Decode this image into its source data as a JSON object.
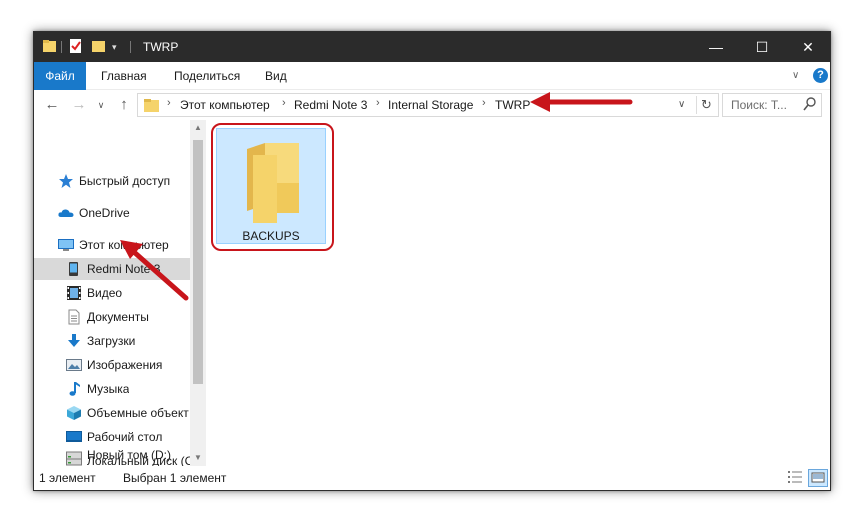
{
  "window": {
    "title": "TWRP",
    "controls": {
      "minimize": "—",
      "maximize": "☐",
      "close": "✕"
    }
  },
  "ribbon": {
    "tabs": [
      {
        "label": "Файл"
      },
      {
        "label": "Главная"
      },
      {
        "label": "Поделиться"
      },
      {
        "label": "Вид"
      }
    ],
    "help": "?"
  },
  "address": {
    "crumbs": [
      "Этот компьютер",
      "Redmi Note 3",
      "Internal Storage",
      "TWRP"
    ],
    "search_placeholder": "Поиск: Т..."
  },
  "nav": {
    "items": [
      {
        "label": "Быстрый доступ",
        "icon": "star-icon"
      },
      {
        "label": "OneDrive",
        "icon": "cloud-icon"
      },
      {
        "label": "Этот компьютер",
        "icon": "computer-icon"
      },
      {
        "label": "Redmi Note 3",
        "icon": "phone-icon",
        "selected": true
      },
      {
        "label": "Видео",
        "icon": "video-icon"
      },
      {
        "label": "Документы",
        "icon": "document-icon"
      },
      {
        "label": "Загрузки",
        "icon": "download-icon"
      },
      {
        "label": "Изображения",
        "icon": "image-icon"
      },
      {
        "label": "Музыка",
        "icon": "music-icon"
      },
      {
        "label": "Объемные объект",
        "icon": "cube-icon"
      },
      {
        "label": "Рабочий стол",
        "icon": "desktop-icon"
      },
      {
        "label": "Локальный диск (С",
        "icon": "drive-icon"
      },
      {
        "label": "Новый том (D:)",
        "icon": "drive-icon"
      }
    ]
  },
  "content": {
    "items": [
      {
        "name": "BACKUPS",
        "type": "folder",
        "selected": true
      }
    ]
  },
  "status": {
    "count": "1 элемент",
    "selected": "Выбран 1 элемент"
  },
  "colors": {
    "accent": "#1979ca",
    "annotation": "#c8151b",
    "selection": "#cce8ff",
    "folder": "#f5d36a"
  }
}
